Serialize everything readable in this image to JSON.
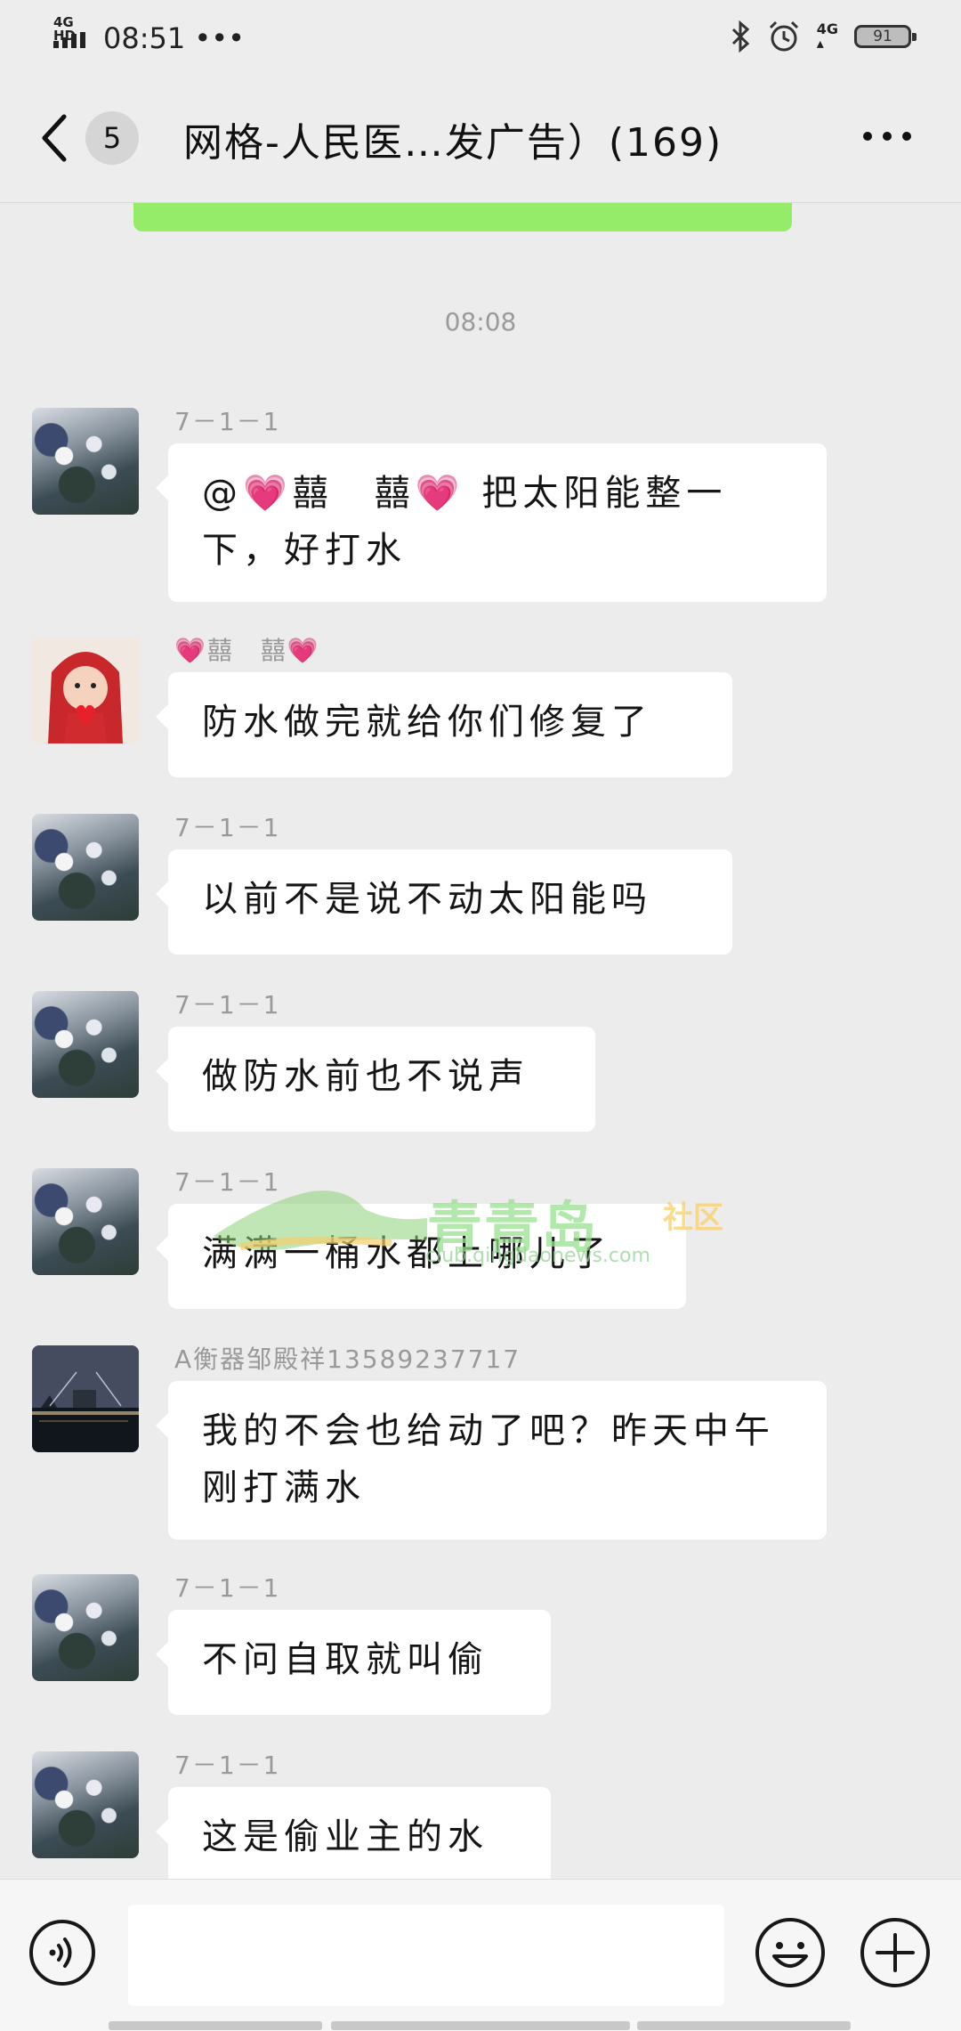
{
  "status_bar": {
    "network": "4G HD",
    "time": "08:51",
    "dots": "•••",
    "lte": "4G",
    "battery": "91"
  },
  "header": {
    "unread_count": "5",
    "title": "网格-人民医…发广告）(169)"
  },
  "chat": {
    "time_separator": "08:08",
    "messages": [
      {
        "sender": "7－1－1",
        "avatar": "flower",
        "text": "@💗囍　囍💗 把太阳能整一下，好打水"
      },
      {
        "sender": "💗囍　囍💗",
        "avatar": "girl",
        "text": "防水做完就给你们修复了"
      },
      {
        "sender": "7－1－1",
        "avatar": "flower",
        "text": "以前不是说不动太阳能吗"
      },
      {
        "sender": "7－1－1",
        "avatar": "flower",
        "text": "做防水前也不说声"
      },
      {
        "sender": "7－1－1",
        "avatar": "flower",
        "text": "满满一桶水都上哪儿了"
      },
      {
        "sender": "A衡器邹殿祥13589237717",
        "avatar": "night",
        "text": "我的不会也给动了吧？昨天中午刚打满水"
      },
      {
        "sender": "7－1－1",
        "avatar": "flower",
        "text": "不问自取就叫偷"
      },
      {
        "sender": "7－1－1",
        "avatar": "flower",
        "text": "这是偷业主的水"
      }
    ]
  },
  "watermark": {
    "name": "青青岛",
    "community": "社区",
    "url": "club.qingdaonews.com"
  },
  "input": {
    "placeholder": ""
  },
  "icons": {
    "back": "chevron-left-icon",
    "more": "more-horizontal-icon",
    "voice": "voice-icon",
    "emoji": "emoji-icon",
    "plus": "plus-icon"
  },
  "colors": {
    "background": "#ececec",
    "bubble": "#ffffff",
    "wechat_green": "#95ec69"
  }
}
